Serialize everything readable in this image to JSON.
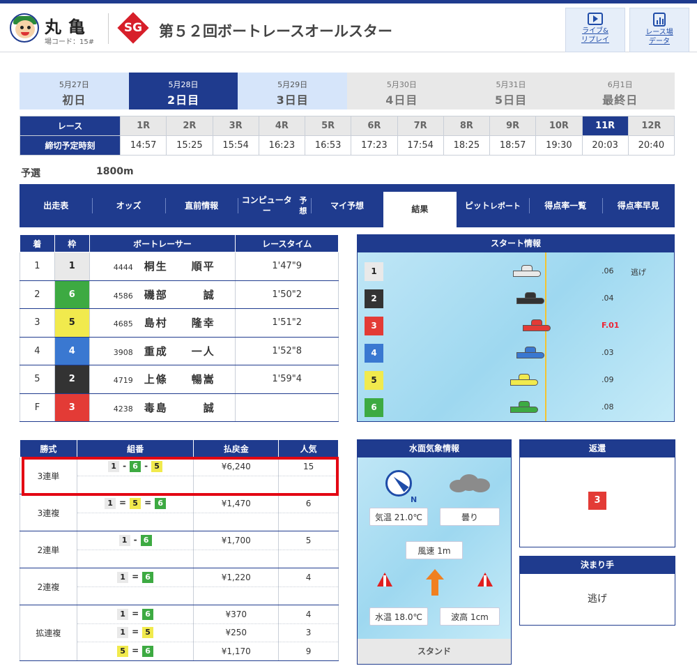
{
  "header": {
    "venue": "丸亀",
    "venue_code": "場コード：15#",
    "grade": "SG",
    "title": "第５２回ボートレースオールスター",
    "live_btn": [
      "ライブ&",
      "リプレイ"
    ],
    "data_btn": [
      "レース場",
      "データ"
    ]
  },
  "days": [
    {
      "date": "5月27日",
      "name": "初日",
      "state": "past"
    },
    {
      "date": "5月28日",
      "name": "2日目",
      "state": "cur"
    },
    {
      "date": "5月29日",
      "name": "3日目",
      "state": "past"
    },
    {
      "date": "5月30日",
      "name": "4日目",
      "state": "fut"
    },
    {
      "date": "5月31日",
      "name": "5日目",
      "state": "fut"
    },
    {
      "date": "6月1日",
      "name": "最終日",
      "state": "fut"
    }
  ],
  "race_table": {
    "race_label": "レース",
    "time_label": "締切予定時刻",
    "races": [
      "1R",
      "2R",
      "3R",
      "4R",
      "5R",
      "6R",
      "7R",
      "8R",
      "9R",
      "10R",
      "11R",
      "12R"
    ],
    "times": [
      "14:57",
      "15:25",
      "15:54",
      "16:23",
      "16:53",
      "17:23",
      "17:54",
      "18:25",
      "18:57",
      "19:30",
      "20:03",
      "20:40"
    ],
    "selected_index": 10
  },
  "race_class": "予選",
  "distance": "1800m",
  "tabs": [
    {
      "label": "出走表"
    },
    {
      "label": "オッズ"
    },
    {
      "label": "直前情報"
    },
    {
      "label": "コンピューター\n予想"
    },
    {
      "label": "マイ予想"
    },
    {
      "label": "結果",
      "active": true
    },
    {
      "label": "ピット\nレポート"
    },
    {
      "label": "得点率一覧"
    },
    {
      "label": "得点率早見"
    }
  ],
  "results": {
    "headers": [
      "着",
      "枠",
      "ボートレーサー",
      "レースタイム"
    ],
    "rows": [
      {
        "rank": "1",
        "waku": "1",
        "regno": "4444",
        "name": "桐生　　順平",
        "time": "1'47\"9"
      },
      {
        "rank": "2",
        "waku": "6",
        "regno": "4586",
        "name": "磯部　　　誠",
        "time": "1'50\"2"
      },
      {
        "rank": "3",
        "waku": "5",
        "regno": "4685",
        "name": "島村　　隆幸",
        "time": "1'51\"2"
      },
      {
        "rank": "4",
        "waku": "4",
        "regno": "3908",
        "name": "重成　　一人",
        "time": "1'52\"8"
      },
      {
        "rank": "5",
        "waku": "2",
        "regno": "4719",
        "name": "上條　　暢嵩",
        "time": "1'59\"4"
      },
      {
        "rank": "F",
        "waku": "3",
        "regno": "4238",
        "name": "毒島　　　誠",
        "time": ""
      }
    ]
  },
  "start_info": {
    "title": "スタート情報",
    "lanes": [
      {
        "waku": "1",
        "st": ".06",
        "kimarite": "逃げ",
        "fly": false,
        "color": "#e9e9e9",
        "boat_offset": 0.47
      },
      {
        "waku": "2",
        "st": ".04",
        "fly": false,
        "color": "#333333",
        "boat_offset": 0.48
      },
      {
        "waku": "3",
        "st": "F.01",
        "fly": true,
        "color": "#e33b36",
        "boat_offset": 0.5
      },
      {
        "waku": "4",
        "st": ".03",
        "fly": false,
        "color": "#3a78d1",
        "boat_offset": 0.48
      },
      {
        "waku": "5",
        "st": ".09",
        "fly": false,
        "color": "#f1ea4d",
        "boat_offset": 0.46
      },
      {
        "waku": "6",
        "st": ".08",
        "fly": false,
        "color": "#3daa42",
        "boat_offset": 0.46
      }
    ]
  },
  "payouts": {
    "headers": [
      "勝式",
      "組番",
      "払戻金",
      "人気"
    ],
    "groups": [
      {
        "type": "3連単",
        "rows": [
          {
            "combo": [
              "1",
              "6",
              "5"
            ],
            "sep": "-",
            "amount": "¥6,240",
            "pop": "15"
          }
        ],
        "pad": 1
      },
      {
        "type": "3連複",
        "rows": [
          {
            "combo": [
              "1",
              "5",
              "6"
            ],
            "sep": "=",
            "amount": "¥1,470",
            "pop": "6"
          }
        ],
        "pad": 1
      },
      {
        "type": "2連単",
        "rows": [
          {
            "combo": [
              "1",
              "6"
            ],
            "sep": "-",
            "amount": "¥1,700",
            "pop": "5"
          }
        ],
        "pad": 1
      },
      {
        "type": "2連複",
        "rows": [
          {
            "combo": [
              "1",
              "6"
            ],
            "sep": "=",
            "amount": "¥1,220",
            "pop": "4"
          }
        ],
        "pad": 1
      },
      {
        "type": "拡連複",
        "rows": [
          {
            "combo": [
              "1",
              "6"
            ],
            "sep": "=",
            "amount": "¥370",
            "pop": "4"
          },
          {
            "combo": [
              "1",
              "5"
            ],
            "sep": "=",
            "amount": "¥250",
            "pop": "3"
          },
          {
            "combo": [
              "5",
              "6"
            ],
            "sep": "=",
            "amount": "¥1,170",
            "pop": "9"
          }
        ],
        "pad": 0
      }
    ]
  },
  "weather": {
    "title": "水面気象情報",
    "north": "N",
    "air_temp": "気温 21.0℃",
    "sky": "曇り",
    "wind": "風速 1m",
    "water_temp": "水温 18.0℃",
    "wave": "波高 1cm",
    "stand": "スタンド"
  },
  "refund": {
    "title": "返還",
    "waku": "3"
  },
  "kimarite": {
    "title": "決まり手",
    "value": "逃げ"
  }
}
